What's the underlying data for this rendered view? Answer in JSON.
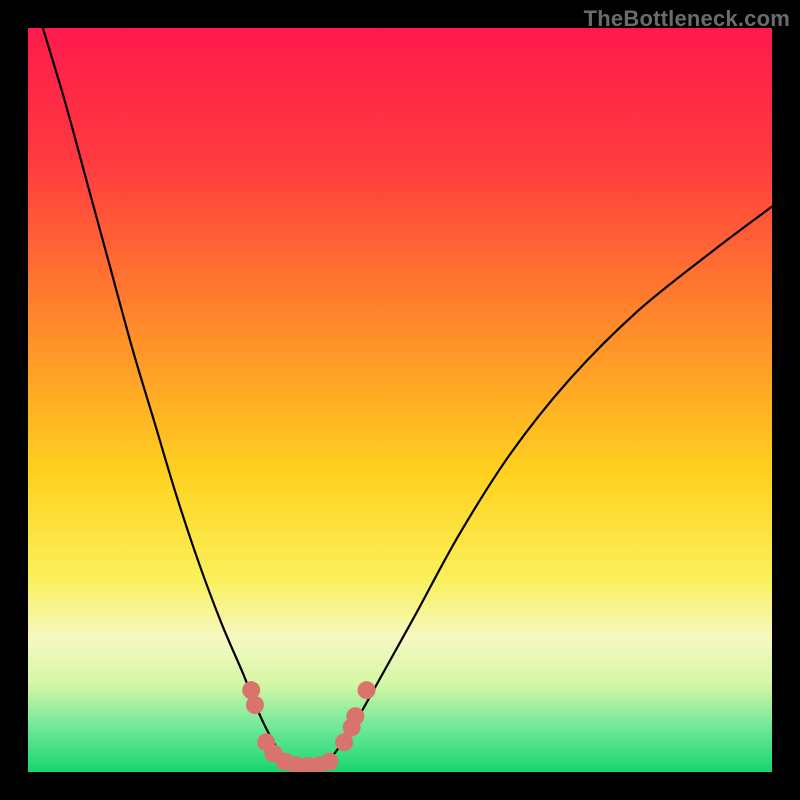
{
  "watermark": "TheBottleneck.com",
  "chart_data": {
    "type": "line",
    "title": "",
    "xlabel": "",
    "ylabel": "",
    "xlim": [
      0,
      100
    ],
    "ylim": [
      0,
      100
    ],
    "gradient_stops": [
      {
        "offset": 0.0,
        "color": "#ff1a4d"
      },
      {
        "offset": 0.18,
        "color": "#ff3b3f"
      },
      {
        "offset": 0.4,
        "color": "#ff8a2a"
      },
      {
        "offset": 0.6,
        "color": "#ffd21f"
      },
      {
        "offset": 0.74,
        "color": "#faf05a"
      },
      {
        "offset": 0.82,
        "color": "#f6f8c2"
      },
      {
        "offset": 0.88,
        "color": "#d6f7a6"
      },
      {
        "offset": 0.94,
        "color": "#6fe89a"
      },
      {
        "offset": 1.0,
        "color": "#17d66e"
      }
    ],
    "series": [
      {
        "name": "left-curve",
        "x": [
          2,
          5,
          8,
          11,
          14,
          17,
          20,
          23,
          26,
          29,
          31,
          33,
          35
        ],
        "y": [
          100,
          90,
          79,
          68,
          57,
          47,
          37,
          28,
          20,
          13,
          8,
          4,
          1
        ]
      },
      {
        "name": "right-curve",
        "x": [
          40,
          43,
          47,
          52,
          58,
          65,
          73,
          82,
          92,
          100
        ],
        "y": [
          1,
          5,
          12,
          21,
          32,
          43,
          53,
          62,
          70,
          76
        ]
      },
      {
        "name": "bottom-flat",
        "x": [
          35,
          36,
          37,
          38,
          39,
          40
        ],
        "y": [
          1,
          0.7,
          0.6,
          0.6,
          0.7,
          1
        ]
      }
    ],
    "markers": {
      "name": "highlight-points",
      "color": "#d9746c",
      "radius_px": 9,
      "points": [
        {
          "x": 30.0,
          "y": 11
        },
        {
          "x": 30.5,
          "y": 9
        },
        {
          "x": 32.0,
          "y": 4
        },
        {
          "x": 33.0,
          "y": 2.5
        },
        {
          "x": 34.5,
          "y": 1.4
        },
        {
          "x": 36.0,
          "y": 0.9
        },
        {
          "x": 37.5,
          "y": 0.8
        },
        {
          "x": 39.0,
          "y": 0.9
        },
        {
          "x": 40.5,
          "y": 1.4
        },
        {
          "x": 42.5,
          "y": 4.0
        },
        {
          "x": 43.5,
          "y": 6.0
        },
        {
          "x": 44.0,
          "y": 7.5
        },
        {
          "x": 45.5,
          "y": 11
        }
      ]
    }
  }
}
